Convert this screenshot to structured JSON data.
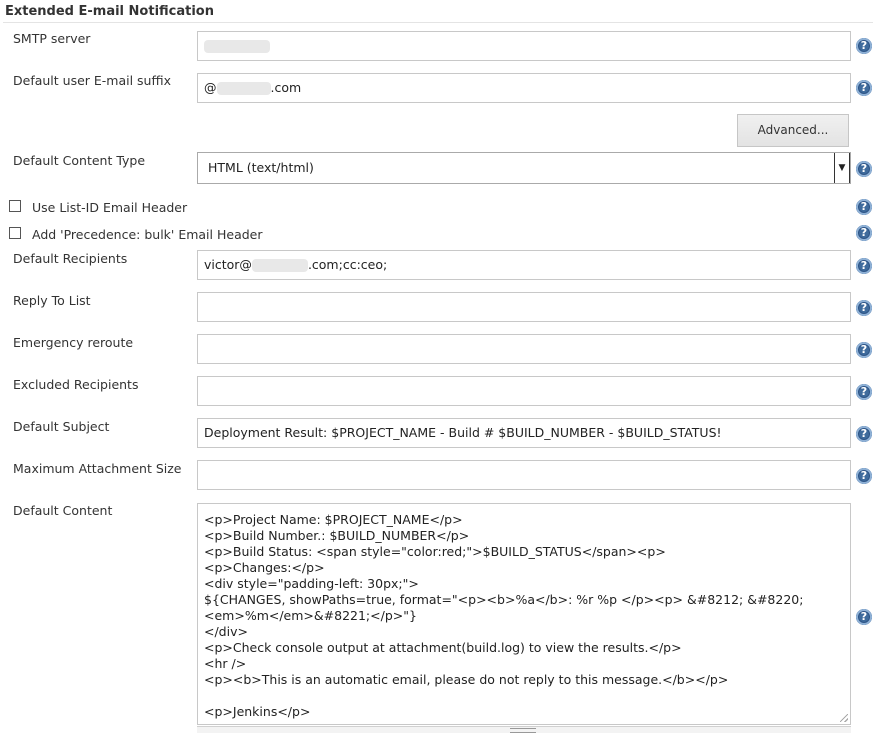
{
  "section": {
    "title": "Extended E-mail Notification"
  },
  "fields": {
    "smtp_server": {
      "label": "SMTP server",
      "value": ""
    },
    "email_suffix": {
      "label": "Default user E-mail suffix",
      "value_prefix": "@",
      "value_suffix": ".com"
    },
    "advanced_button": "Advanced...",
    "content_type": {
      "label": "Default Content Type",
      "selected": "HTML (text/html)"
    },
    "use_list_id": {
      "label": "Use List-ID Email Header",
      "checked": false
    },
    "precedence_bulk": {
      "label": "Add 'Precedence: bulk' Email Header",
      "checked": false
    },
    "default_recipients": {
      "label": "Default Recipients",
      "value_prefix": "victor@",
      "value_suffix": ".com;cc:ceo;"
    },
    "reply_to_list": {
      "label": "Reply To List",
      "value": ""
    },
    "emergency_reroute": {
      "label": "Emergency reroute",
      "value": ""
    },
    "excluded_recipients": {
      "label": "Excluded Recipients",
      "value": ""
    },
    "default_subject": {
      "label": "Default Subject",
      "value": "Deployment Result: $PROJECT_NAME - Build # $BUILD_NUMBER - $BUILD_STATUS!"
    },
    "max_attachment_size": {
      "label": "Maximum Attachment Size",
      "value": ""
    },
    "default_content": {
      "label": "Default Content",
      "lines": [
        "<p>Project Name: $PROJECT_NAME</p>",
        "<p>Build Number.: $BUILD_NUMBER</p>",
        "<p>Build Status: <span style=\"color:red;\">$BUILD_STATUS</span><p>",
        "<p>Changes:</p>",
        "<div style=\"padding-left: 30px;\">",
        "${CHANGES, showPaths=true, format=\"<p><b>%a</b>: %r %p </p><p> &#8212; &#8220;",
        "<em>%m</em>&#8221;</p>\"}",
        "</div>",
        "<p>Check console output at attachment(build.log) to view the results.</p>",
        "<hr />",
        "<p><b>This is an automatic email, please do not reply to this message.</b></p>",
        "",
        "<p>Jenkins</p>"
      ]
    }
  },
  "help_icon": {
    "name": "help-icon",
    "glyph": "?",
    "color": "#3f6b9c"
  }
}
